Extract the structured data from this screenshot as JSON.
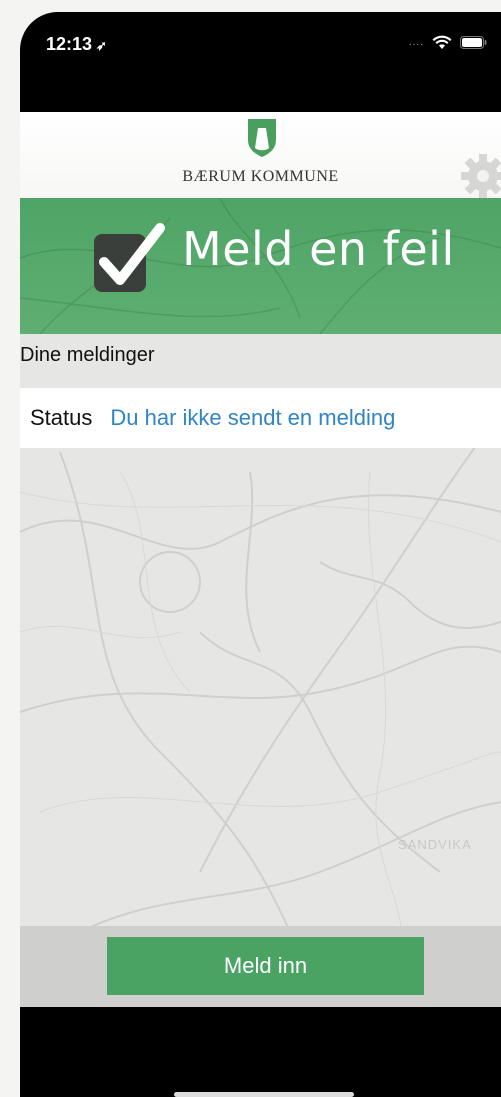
{
  "status_bar": {
    "time": "12:13",
    "location_icon": "location-arrow-icon",
    "signal_dots": "....",
    "wifi_icon": "wifi-icon",
    "battery_icon": "battery-icon"
  },
  "header": {
    "logo_icon": "coat-of-arms-shield-icon",
    "brand": "BÆRUM KOMMUNE",
    "settings_icon": "gear-icon"
  },
  "banner": {
    "icon": "checkbox-checked-icon",
    "title": "Meld en feil",
    "color": "#4fa466"
  },
  "messages": {
    "section_title": "Dine meldinger",
    "status_label": "Status",
    "status_value": "Du har ikke sendt en melding",
    "status_color": "#2f85c5"
  },
  "map": {
    "place_label": "SANDVIKA"
  },
  "actions": {
    "submit_label": "Meld inn"
  }
}
